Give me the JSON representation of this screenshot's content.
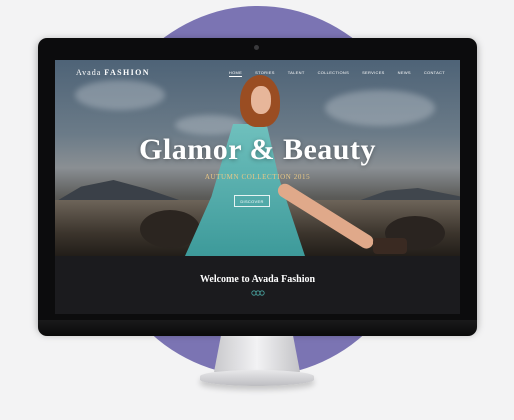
{
  "site": {
    "logo_first": "Avada",
    "logo_second": "FASHION"
  },
  "nav": {
    "items": [
      "HOME",
      "STORIES",
      "TALENT",
      "COLLECTIONS",
      "SERVICES",
      "NEWS",
      "CONTACT"
    ]
  },
  "hero": {
    "headline": "Glamor & Beauty",
    "subtitle": "AUTUMN COLLECTION 2015",
    "button_label": "DISCOVER"
  },
  "welcome": {
    "title": "Welcome to Avada Fashion"
  },
  "colors": {
    "accent_gold": "#e9c886",
    "backdrop_circle": "#7b74b3",
    "welcome_band": "#1b1b1e",
    "ornament": "#4aa7a3"
  },
  "icons": {
    "divider": "ornament-divider-icon",
    "camera": "webcam-dot-icon"
  }
}
